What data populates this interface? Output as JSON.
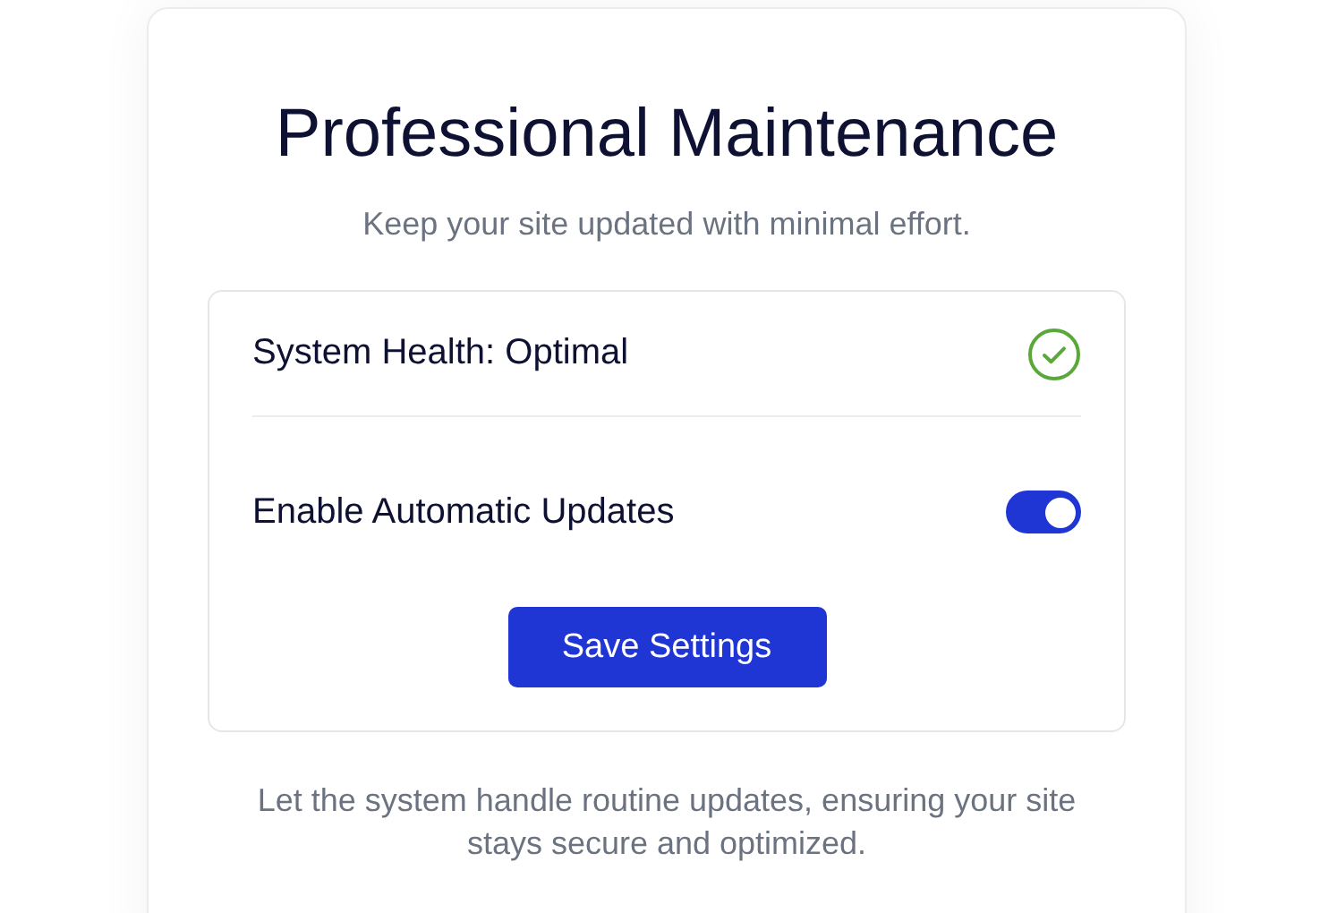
{
  "title": "Professional Maintenance",
  "subtitle": "Keep your site updated with minimal effort.",
  "settings": [
    {
      "kind": "status",
      "label": "System Health: Optimal",
      "ok": true
    },
    {
      "kind": "toggle",
      "label": "Enable Automatic Updates",
      "on": true
    }
  ],
  "save_button": "Save Settings",
  "footer": "Let the system handle routine updates, ensuring your site stays secure and optimized."
}
